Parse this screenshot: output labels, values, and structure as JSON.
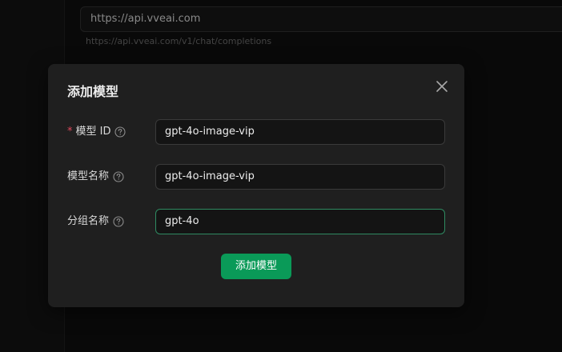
{
  "background": {
    "api_base_value": "https://api.vveai.com",
    "api_endpoint_hint": "https://api.vveai.com/v1/chat/completions"
  },
  "modal": {
    "title": "添加模型",
    "close_icon": "close-icon",
    "fields": [
      {
        "label": "模型 ID",
        "required": true,
        "help_icon": "question-circle-icon",
        "value": "gpt-4o-image-vip"
      },
      {
        "label": "模型名称",
        "required": false,
        "help_icon": "question-circle-icon",
        "value": "gpt-4o-image-vip"
      },
      {
        "label": "分组名称",
        "required": false,
        "help_icon": "question-circle-icon",
        "value": "gpt-4o"
      }
    ],
    "required_marker": "*",
    "submit_label": "添加模型"
  },
  "colors": {
    "accent": "#0a9a58",
    "required": "#e0495d",
    "modal_bg": "#1f1f1f",
    "page_bg": "#0d0d0d"
  }
}
